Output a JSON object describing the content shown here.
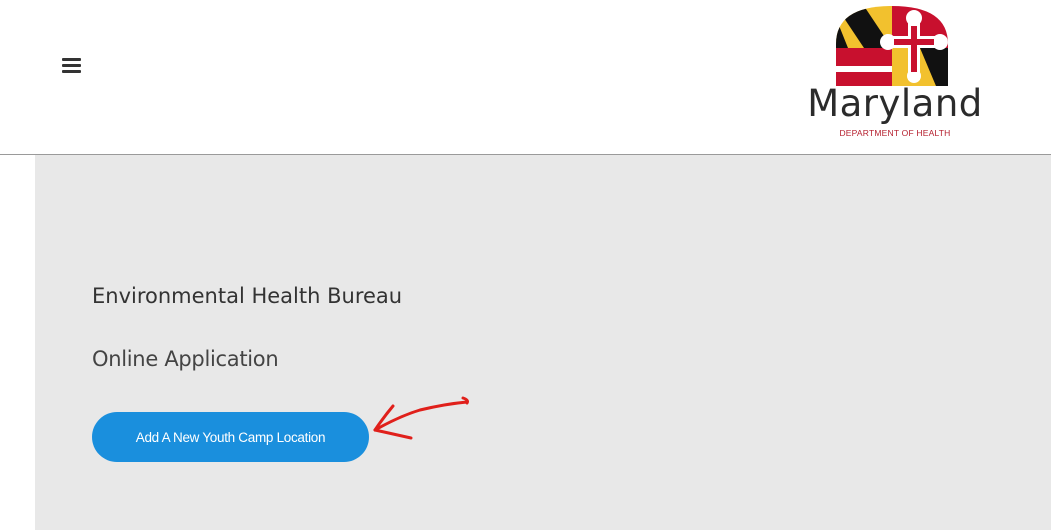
{
  "header": {
    "menu_icon": "hamburger-menu-icon",
    "logo": {
      "name": "Maryland",
      "department": "DEPARTMENT OF HEALTH",
      "colors": {
        "black": "#111111",
        "gold": "#f2c12e",
        "red": "#c8102e",
        "white": "#ffffff"
      }
    }
  },
  "main": {
    "title": "Environmental Health Bureau",
    "subtitle": "Online Application",
    "add_button_label": "Add A New Youth Camp Location",
    "colors": {
      "button": "#1a8fdd",
      "background": "#e8e8e8",
      "annotation": "#e0201b"
    }
  }
}
